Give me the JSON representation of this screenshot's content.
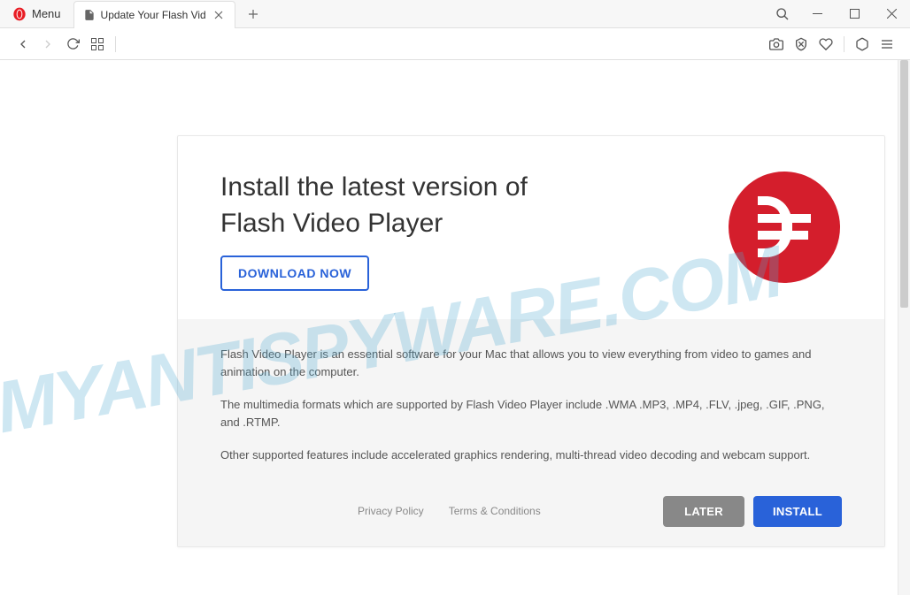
{
  "titlebar": {
    "menu_label": "Menu",
    "tab_title": "Update Your Flash Vid"
  },
  "page": {
    "heading_line1": "Install the latest version of",
    "heading_line2": "Flash Video Player",
    "download_label": "DOWNLOAD NOW",
    "paragraphs": [
      "Flash Video Player is an essential software for your Mac that allows you to view everything from video to games and animation on the computer.",
      "The multimedia formats which are supported by Flash Video Player include .WMA .MP3, .MP4, .FLV, .jpeg, .GIF, .PNG, and .RTMP.",
      "Other supported features include accelerated graphics rendering, multi-thread video decoding and webcam support."
    ],
    "footer": {
      "privacy": "Privacy Policy",
      "terms": "Terms & Conditions",
      "later": "LATER",
      "install": "INSTALL"
    }
  },
  "watermark": "MYANTISPYWARE.COM"
}
